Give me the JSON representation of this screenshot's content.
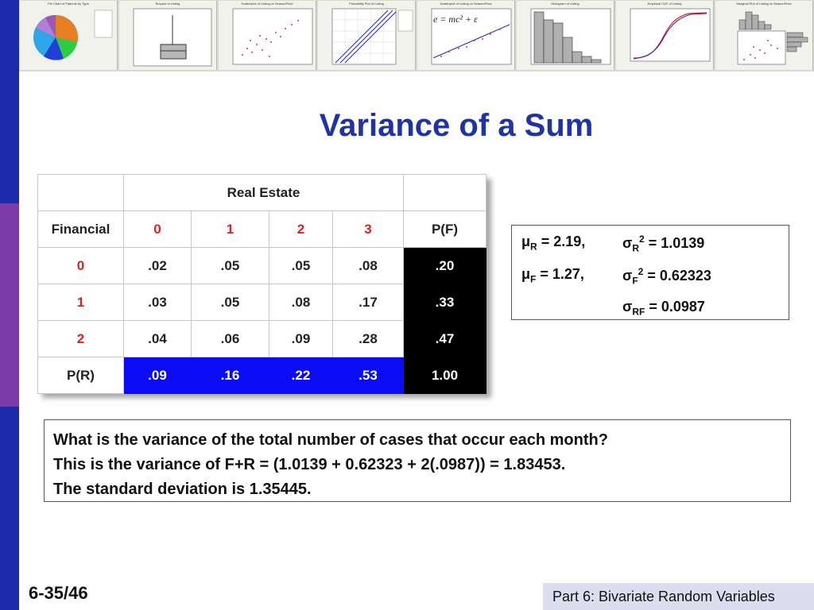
{
  "sidebar": {
    "bands": [
      {
        "color": "#1c2cac"
      },
      {
        "color": "#7a3aa8"
      },
      {
        "color": "#1c2cac"
      }
    ]
  },
  "thumbnails": [
    {
      "title": "Pie Chart of Patients by Type",
      "kind": "pie"
    },
    {
      "title": "Boxplot of Listing",
      "kind": "boxplot"
    },
    {
      "title": "Scatterplot of Listing vs SeasonPrice",
      "kind": "scatter"
    },
    {
      "title": "Probability Plot of Listing",
      "kind": "probplot"
    },
    {
      "title": "Scatterplot of Listing vs SeasonPrice",
      "kind": "regression",
      "formula": "e = mc² + ε"
    },
    {
      "title": "Histogram of Listing",
      "kind": "histogram"
    },
    {
      "title": "Empirical CDF of Listing",
      "kind": "cdf"
    },
    {
      "title": "Marginal Plot of Listing vs SeasonPrice",
      "kind": "marginal"
    }
  ],
  "title": "Variance of a Sum",
  "table": {
    "super_header": "Real Estate",
    "row_header": "Financial",
    "columns": [
      "0",
      "1",
      "2",
      "3"
    ],
    "total_col_label": "P(F)",
    "rows": [
      {
        "label": "0",
        "cells": [
          ".02",
          ".05",
          ".05",
          ".08"
        ],
        "total": ".20"
      },
      {
        "label": "1",
        "cells": [
          ".03",
          ".05",
          ".08",
          ".17"
        ],
        "total": ".33"
      },
      {
        "label": "2",
        "cells": [
          ".04",
          ".06",
          ".09",
          ".28"
        ],
        "total": ".47"
      }
    ],
    "total_row": {
      "label": "P(R)",
      "cells": [
        ".09",
        ".16",
        ".22",
        ".53"
      ],
      "total": "1.00"
    }
  },
  "stats": {
    "muR_sym": "μ",
    "muR_sub": "R",
    "muR_val": " = 2.19,",
    "sR_sym": "σ",
    "sR_sub": "R",
    "sR_sup": "2",
    "sR_val": " = 1.0139",
    "muF_sym": "μ",
    "muF_sub": "F",
    "muF_val": " = 1.27,",
    "sF_sym": "σ",
    "sF_sub": "F",
    "sF_sup": "2",
    "sF_val": " = 0.62323",
    "sRF_sym": "σ",
    "sRF_sub": "RF",
    "sRF_val": " = 0.0987"
  },
  "question": {
    "line1": "What is the variance of the total number of cases that occur each month?",
    "line2": "This is the variance of F+R = (1.0139 + 0.62323 + 2(.0987)) = 1.83453.",
    "line3": "The standard deviation is 1.35445."
  },
  "footer": {
    "slide_number": "6-35/46",
    "section": "Part 6: Bivariate Random Variables"
  }
}
